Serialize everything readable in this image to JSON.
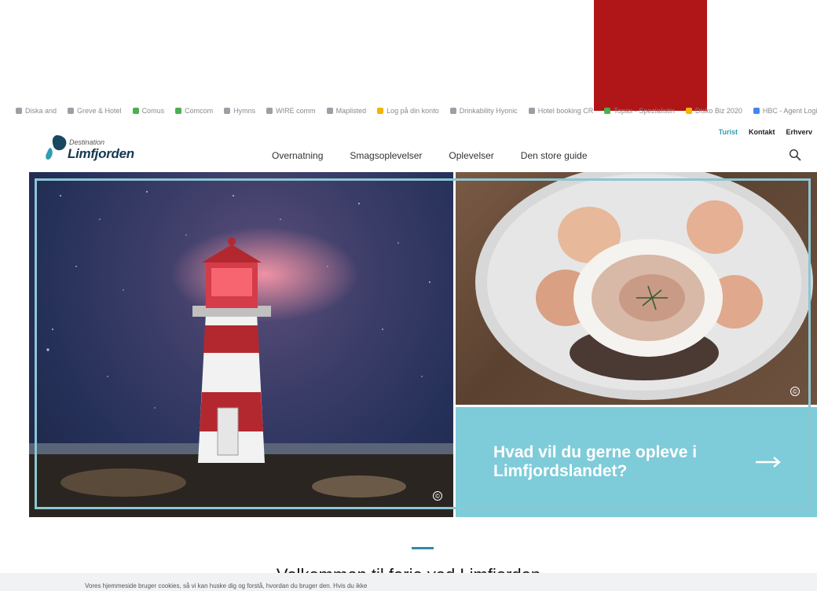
{
  "bookmarks": [
    {
      "label": "Diska and",
      "color": "#9aa0a6"
    },
    {
      "label": "Greve & Hotel",
      "color": "#9aa0a6"
    },
    {
      "label": "Comus",
      "color": "#4caf50"
    },
    {
      "label": "Comcom",
      "color": "#4caf50"
    },
    {
      "label": "Hymns",
      "color": "#9aa0a6"
    },
    {
      "label": "WIRE comm",
      "color": "#9aa0a6"
    },
    {
      "label": "Maplisted",
      "color": "#9aa0a6"
    },
    {
      "label": "Log på din konto",
      "color": "#f4b400"
    },
    {
      "label": "Drinkability Hyonic",
      "color": "#9aa0a6"
    },
    {
      "label": "Hotel booking CR",
      "color": "#9aa0a6"
    },
    {
      "label": "Topas - Spezialistin",
      "color": "#4caf50"
    },
    {
      "label": "Disko Biz 2020",
      "color": "#f4b400"
    },
    {
      "label": "HBC - Agent Login",
      "color": "#4285f4"
    }
  ],
  "logo": {
    "small": "Destination",
    "big": "Limfjorden",
    "color": "#123a52"
  },
  "topnav": {
    "turist": "Turist",
    "kontakt": "Kontakt",
    "erhverv": "Erhverv"
  },
  "mainnav": [
    "Overnatning",
    "Smagsoplevelser",
    "Oplevelser",
    "Den store guide"
  ],
  "hero": {
    "cta_text": "Hvad vil du gerne opleve i Limfjordslandet?",
    "cta_color": "#7ecbd9",
    "copyright_symbol": "©"
  },
  "welcome": {
    "title": "Velkommen til ferie ved Limfjorden"
  },
  "cookie": {
    "text": "Vores hjemmeside bruger cookies, så vi kan huske dig og forstå, hvordan du bruger den. Hvis du ikke"
  },
  "colors": {
    "accent": "#2f9db5",
    "red_block": "#b01617",
    "frame": "#8cc7d3"
  }
}
